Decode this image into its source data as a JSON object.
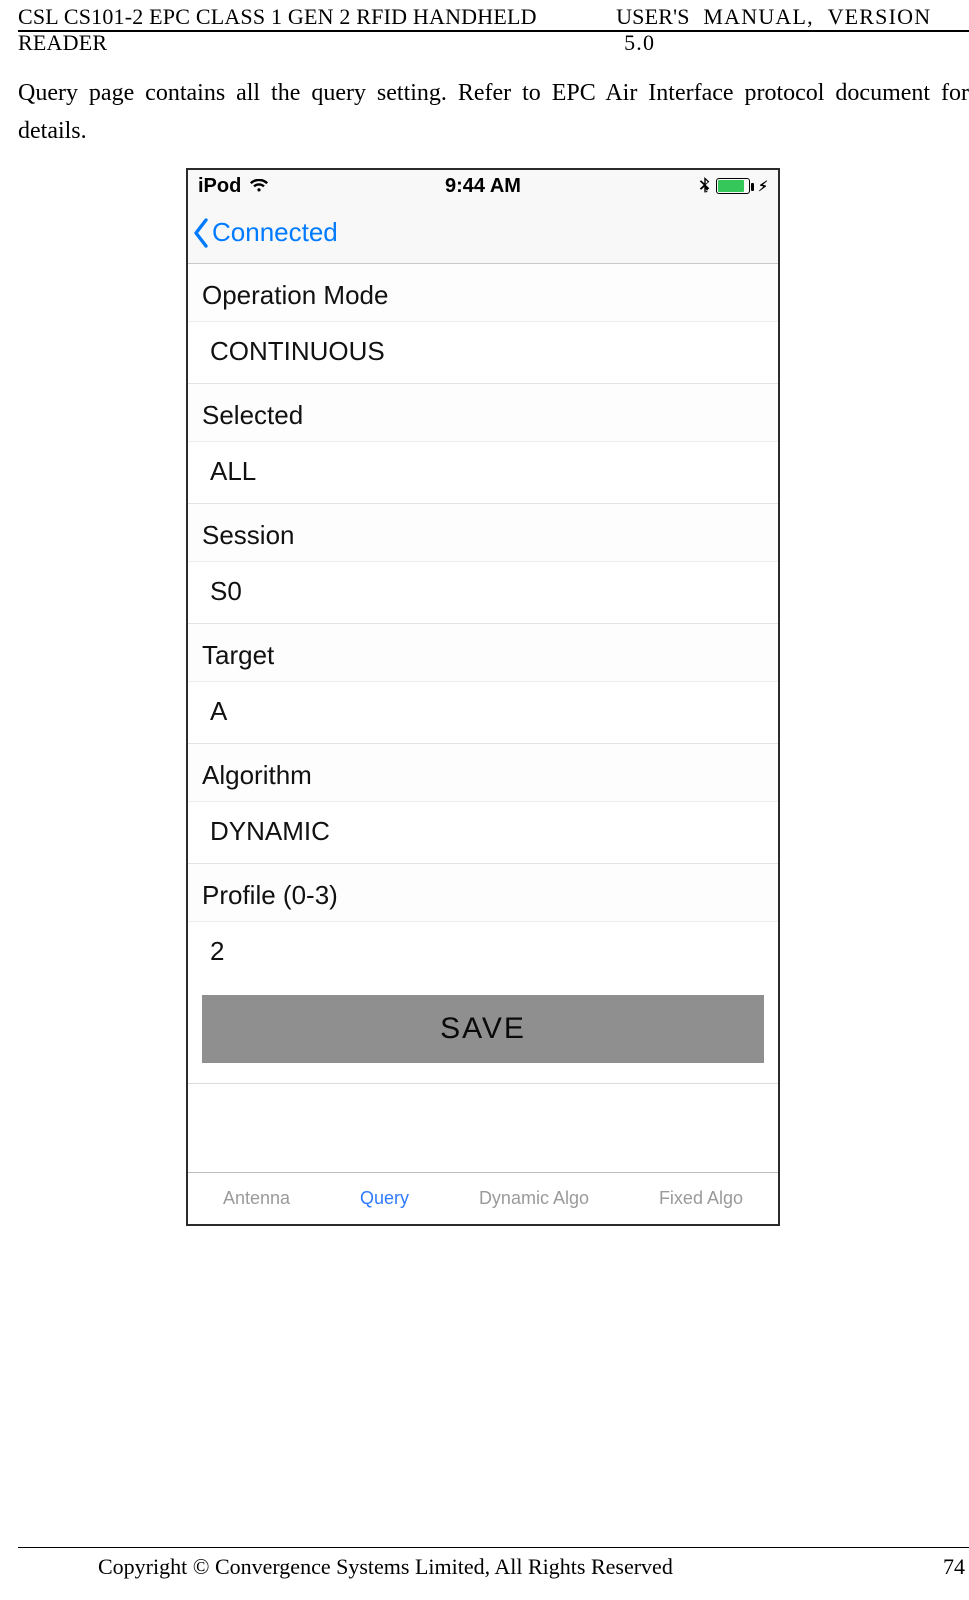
{
  "header": {
    "left": "CSL CS101-2 EPC CLASS 1 GEN 2 RFID HANDHELD READER",
    "right_a": "USER'S",
    "right_b": "MANUAL,",
    "right_c": "VERSION",
    "right_d": "5.0"
  },
  "paragraph": "Query page contains all the query setting.    Refer to EPC Air Interface protocol document for details.",
  "statusbar": {
    "carrier": "iPod",
    "time": "9:44 AM"
  },
  "nav": {
    "back_label": "Connected"
  },
  "form": {
    "operation_mode": {
      "label": "Operation Mode",
      "value": "CONTINUOUS"
    },
    "selected": {
      "label": "Selected",
      "value": "ALL"
    },
    "session": {
      "label": "Session",
      "value": "S0"
    },
    "target": {
      "label": "Target",
      "value": "A"
    },
    "algorithm": {
      "label": "Algorithm",
      "value": "DYNAMIC"
    },
    "profile": {
      "label": "Profile (0-3)",
      "value": "2"
    },
    "save_label": "SAVE"
  },
  "tabs": {
    "antenna": "Antenna",
    "query": "Query",
    "dynamic": "Dynamic Algo",
    "fixed": "Fixed Algo"
  },
  "footer": {
    "copyright": "Copyright © Convergence Systems Limited, All Rights Reserved",
    "page": "74"
  },
  "icons": {
    "wifi": "wifi-icon",
    "bluetooth": "bluetooth-icon",
    "battery": "battery-icon",
    "bolt": "charging-bolt-icon",
    "back_chevron": "chevron-left-icon"
  }
}
